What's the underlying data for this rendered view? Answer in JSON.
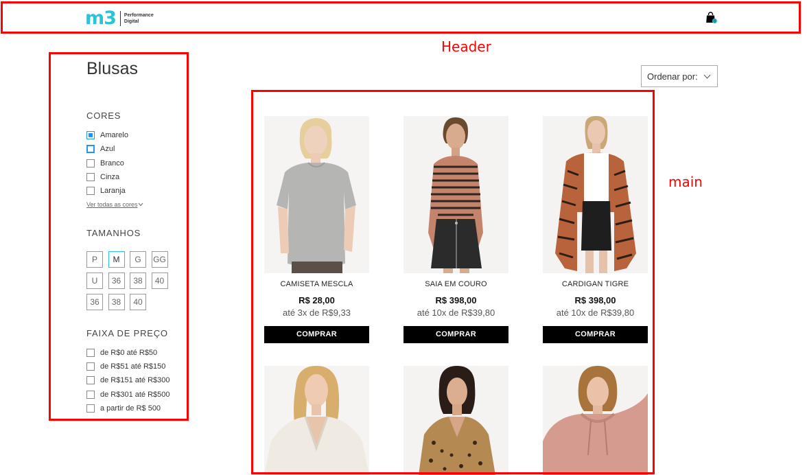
{
  "header": {
    "logo_mark": "m3",
    "logo_line1": "Performance",
    "logo_line2": "Digital",
    "cart_count": "0"
  },
  "annotations": {
    "header_label": "Header",
    "main_label": "main"
  },
  "sidebar": {
    "title": "Blusas",
    "colors_title": "CORES",
    "colors": [
      {
        "label": "Amarelo",
        "state": "checked"
      },
      {
        "label": "Azul",
        "state": "focused"
      },
      {
        "label": "Branco",
        "state": "unchecked"
      },
      {
        "label": "Cinza",
        "state": "unchecked"
      },
      {
        "label": "Laranja",
        "state": "unchecked"
      }
    ],
    "see_all": "Ver todas as cores",
    "sizes_title": "TAMANHOS",
    "sizes": [
      "P",
      "M",
      "G",
      "GG",
      "U",
      "36",
      "38",
      "40",
      "36",
      "38",
      "40"
    ],
    "selected_size": "M",
    "price_title": "FAIXA DE PREÇO",
    "prices": [
      "de R$0 até R$50",
      "de R$51 até R$150",
      "de R$151 até R$300",
      "de R$301 até R$500",
      "a partir de R$ 500"
    ]
  },
  "sort": {
    "label": "Ordenar por:"
  },
  "products": [
    {
      "name": "CAMISETA MESCLA",
      "price": "R$ 28,00",
      "installments": "até 3x de R$9,33",
      "button": "COMPRAR"
    },
    {
      "name": "SAIA EM COURO",
      "price": "R$ 398,00",
      "installments": "até 10x de R$39,80",
      "button": "COMPRAR"
    },
    {
      "name": "CARDIGAN TIGRE",
      "price": "R$ 398,00",
      "installments": "até 10x de R$39,80",
      "button": "COMPRAR"
    }
  ],
  "colors": {
    "accent": "#2bc3d9",
    "annotation": "#ff0000",
    "checkbox_active": "#2196f3"
  }
}
